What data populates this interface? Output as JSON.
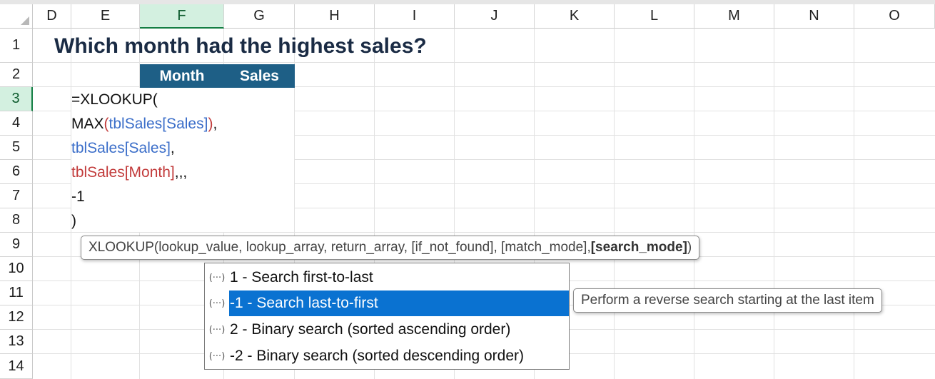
{
  "columns": [
    "D",
    "E",
    "F",
    "G",
    "H",
    "I",
    "J",
    "K",
    "L",
    "M",
    "N",
    "O"
  ],
  "rows": [
    "1",
    "2",
    "3",
    "4",
    "5",
    "6",
    "7",
    "8",
    "9",
    "10",
    "11",
    "12",
    "13",
    "14"
  ],
  "title": "Which month had the highest sales?",
  "table_headers": {
    "month": "Month",
    "sales": "Sales"
  },
  "formula": {
    "line1": "=XLOOKUP(",
    "line2_fn": "MAX",
    "line2_open": "(",
    "line2_ref": "tblSales[Sales]",
    "line2_close": ")",
    "line2_tail": ",",
    "line3_ref": "tblSales[Sales]",
    "line3_tail": ",",
    "line4_ref": "tblSales[Month]",
    "line4_tail": ",,,",
    "line5": "-1",
    "line6": ")"
  },
  "tooltip": {
    "prefix": "XLOOKUP(lookup_value, lookup_array, return_array, [if_not_found], [match_mode], ",
    "bold": "[search_mode]",
    "suffix": ")"
  },
  "dropdown": {
    "icon_glyph": "(···)",
    "options": [
      {
        "label": "1 - Search first-to-last"
      },
      {
        "label": "-1 - Search last-to-first"
      },
      {
        "label": "2 - Binary search (sorted ascending order)"
      },
      {
        "label": "-2 - Binary search (sorted descending order)"
      }
    ],
    "selected_description": "Perform a reverse search starting at the last item"
  },
  "colors": {
    "header_blue": "#1e5f86",
    "selection_blue": "#0a72d1",
    "selected_green": "#137e43"
  }
}
